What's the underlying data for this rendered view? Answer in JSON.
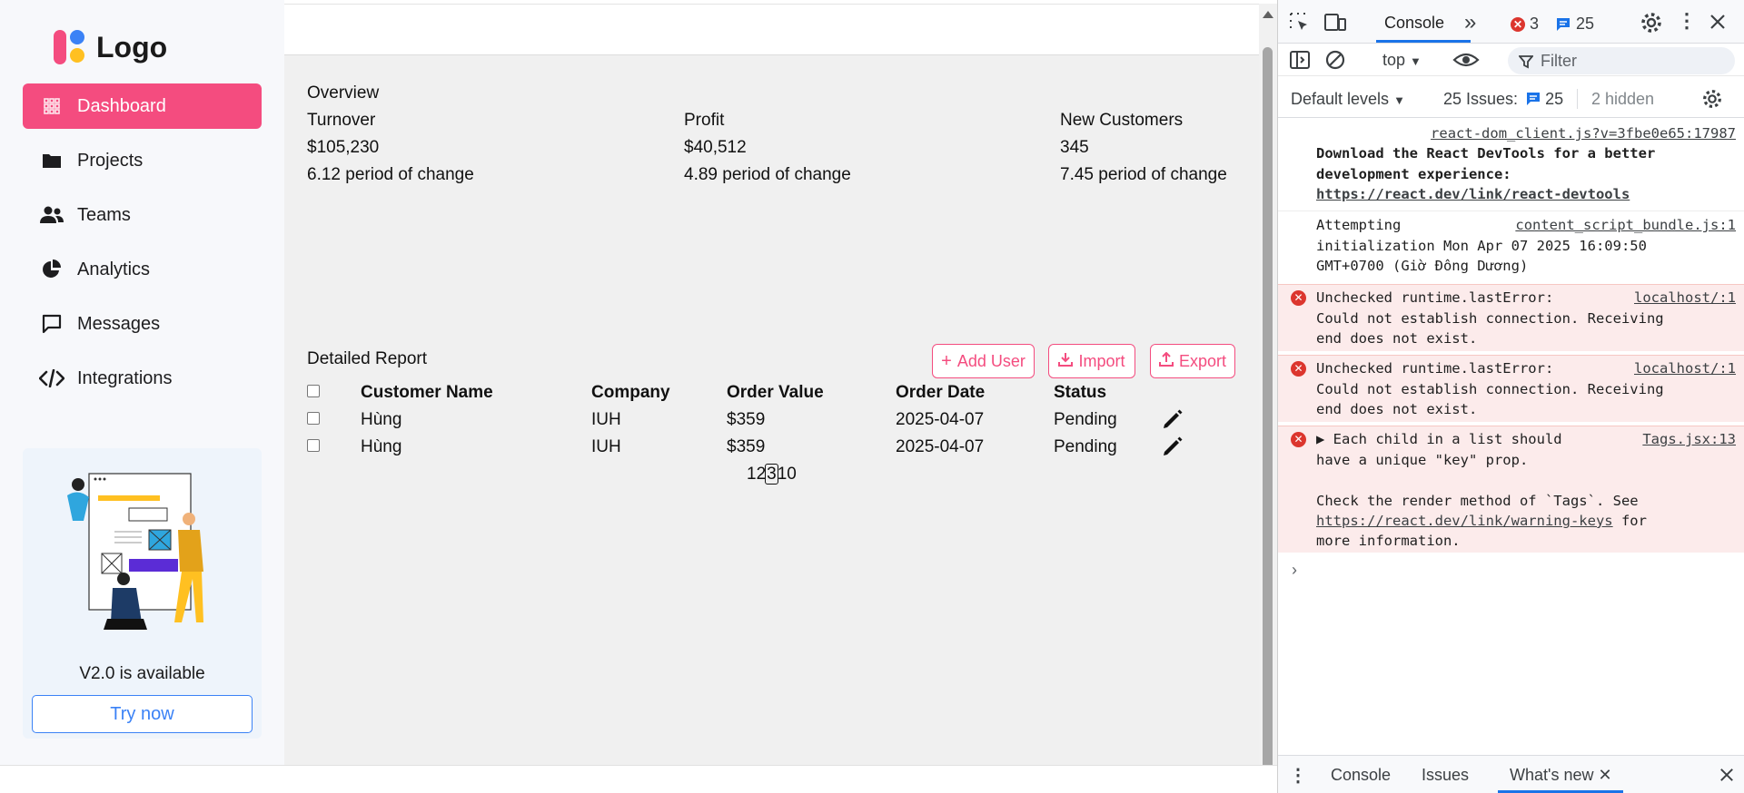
{
  "app": {
    "logo_text": "Logo",
    "nav": [
      {
        "label": "Dashboard",
        "icon": "grid-icon",
        "active": true
      },
      {
        "label": "Projects",
        "icon": "folder-icon",
        "active": false
      },
      {
        "label": "Teams",
        "icon": "users-icon",
        "active": false
      },
      {
        "label": "Analytics",
        "icon": "pie-chart-icon",
        "active": false
      },
      {
        "label": "Messages",
        "icon": "message-icon",
        "active": false
      },
      {
        "label": "Integrations",
        "icon": "code-icon",
        "active": false
      }
    ],
    "promo": {
      "title": "V2.0 is available",
      "button": "Try now"
    },
    "colors": {
      "accent": "#f44c7f",
      "link": "#3b82f6"
    }
  },
  "overview": {
    "title": "Overview",
    "cards": [
      {
        "label": "Turnover",
        "value": "$105,230",
        "change": "6.12 period of change"
      },
      {
        "label": "Profit",
        "value": "$40,512",
        "change": "4.89 period of change"
      },
      {
        "label": "New Customers",
        "value": "345",
        "change": "7.45 period of change"
      }
    ]
  },
  "report": {
    "title": "Detailed Report",
    "buttons": {
      "add_user": "Add User",
      "import": "Import",
      "export": "Export"
    },
    "columns": [
      "Customer Name",
      "Company",
      "Order Value",
      "Order Date",
      "Status"
    ],
    "rows": [
      {
        "customer": "Hùng",
        "company": "IUH",
        "order_value": "$359",
        "order_date": "2025-04-07",
        "status": "Pending"
      },
      {
        "customer": "Hùng",
        "company": "IUH",
        "order_value": "$359",
        "order_date": "2025-04-07",
        "status": "Pending"
      }
    ],
    "pagination": {
      "before": "12",
      "current": "3",
      "after": "10"
    }
  },
  "devtools": {
    "tabs": {
      "console": "Console",
      "more": "»"
    },
    "errors_count": "3",
    "messages_count": "25",
    "context": "top",
    "filter_placeholder": "Filter",
    "levels": "Default levels",
    "issues_label": "25 Issues:",
    "issues_count": "25",
    "hidden": "2 hidden",
    "logs": {
      "react_src": "react-dom_client.js?v=3fbe0e65:17987",
      "react_msg": "Download the React DevTools for a better\ndevelopment experience:",
      "react_link": "https://react.dev/link/react-devtools",
      "attempt_msg": "Attempting\ninitialization Mon Apr 07 2025 16:09:50\nGMT+0700 (Giờ Đông Dương)",
      "attempt_src": "content_script_bundle.js:1",
      "err1_msg": "Unchecked runtime.lastError:\nCould not establish connection. Receiving\nend does not exist.",
      "err1_src": "localhost/:1",
      "err2_msg": "Unchecked runtime.lastError:\nCould not establish connection. Receiving\nend does not exist.",
      "err2_src": "localhost/:1",
      "err3_msg": "▶ Each child in a list should\nhave a unique \"key\" prop.\n\nCheck the render method of `Tags`. See",
      "err3_link": "https://react.dev/link/warning-keys",
      "err3_tail": " for",
      "err3_end": "more information.",
      "err3_src": "Tags.jsx:13"
    },
    "bottom_tabs": {
      "console": "Console",
      "issues": "Issues",
      "whats_new": "What's new"
    }
  }
}
